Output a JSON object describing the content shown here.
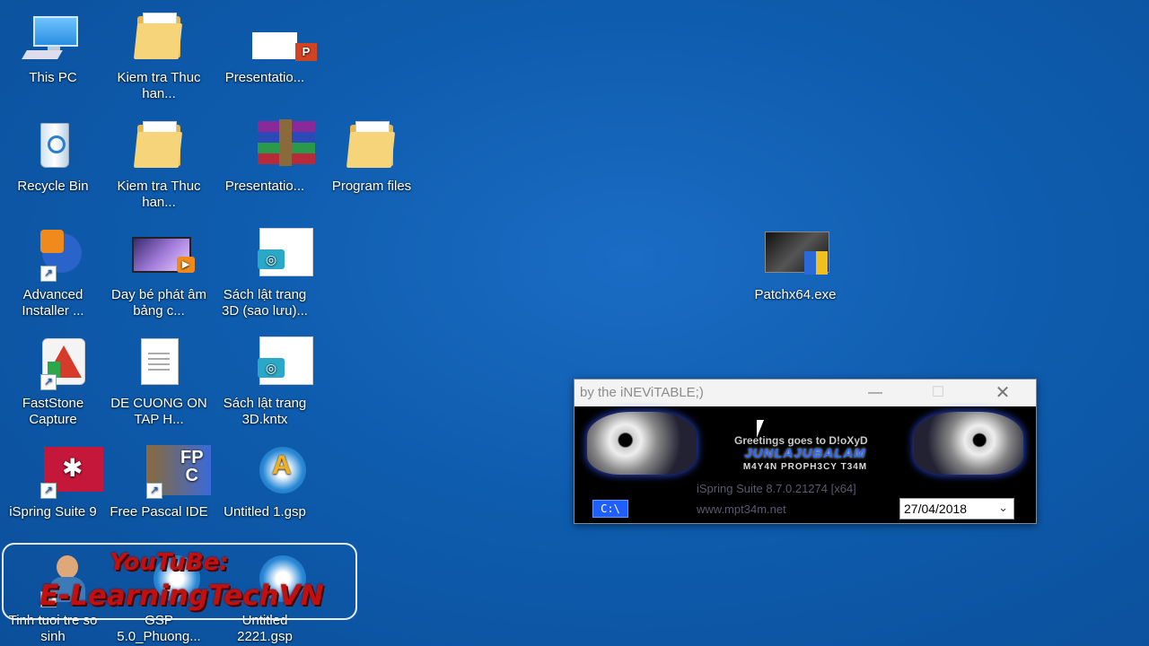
{
  "desktop": {
    "icons": [
      {
        "id": "this-pc",
        "label": "This PC"
      },
      {
        "id": "kiem-tra-1",
        "label": "Kiem tra Thuc han..."
      },
      {
        "id": "presentation-ppt",
        "label": "Presentatio..."
      },
      {
        "id": "recycle-bin",
        "label": "Recycle Bin"
      },
      {
        "id": "kiem-tra-2",
        "label": "Kiem tra Thuc han..."
      },
      {
        "id": "presentation-rar",
        "label": "Presentatio..."
      },
      {
        "id": "program-files",
        "label": "Program files"
      },
      {
        "id": "advanced-installer",
        "label": "Advanced Installer ..."
      },
      {
        "id": "day-be-phat",
        "label": "Day bé phát âm bảng c..."
      },
      {
        "id": "sach-lat-trang-1",
        "label": "Sách lật trang 3D (sao lưu)..."
      },
      {
        "id": "faststone",
        "label": "FastStone Capture"
      },
      {
        "id": "de-cuong",
        "label": "DE CUONG ON TAP H..."
      },
      {
        "id": "sach-lat-trang-2",
        "label": "Sách lật trang 3D.kntx"
      },
      {
        "id": "ispring",
        "label": "iSpring Suite 9"
      },
      {
        "id": "free-pascal",
        "label": "Free Pascal IDE"
      },
      {
        "id": "untitled-1",
        "label": "Untitled 1.gsp"
      },
      {
        "id": "tinh-tuoi",
        "label": "Tinh tuoi tre so sinh"
      },
      {
        "id": "gsp-5",
        "label": "GSP 5.0_Phuong..."
      },
      {
        "id": "untitled-2221",
        "label": "Untitled 2221.gsp"
      },
      {
        "id": "patch",
        "label": "Patchx64.exe"
      }
    ]
  },
  "patch_window": {
    "title": "by the iNEViTABLE;)",
    "greetings": "Greetings goes to D!oXyD",
    "banner_line1": "JUNLAJUBALAM",
    "banner_line2": "M4Y4N PROPH3CY T34M",
    "product": "iSpring Suite 8.7.0.21274 [x64]",
    "url": "www.mpt34m.net",
    "path_button": "C:\\",
    "date": "27/04/2018"
  },
  "watermark": {
    "line1": "YouTuBe:",
    "line2": "E-LearningTechVN"
  },
  "colors": {
    "desktop": "#0e5cae",
    "banner_blue": "#1f5fff"
  }
}
